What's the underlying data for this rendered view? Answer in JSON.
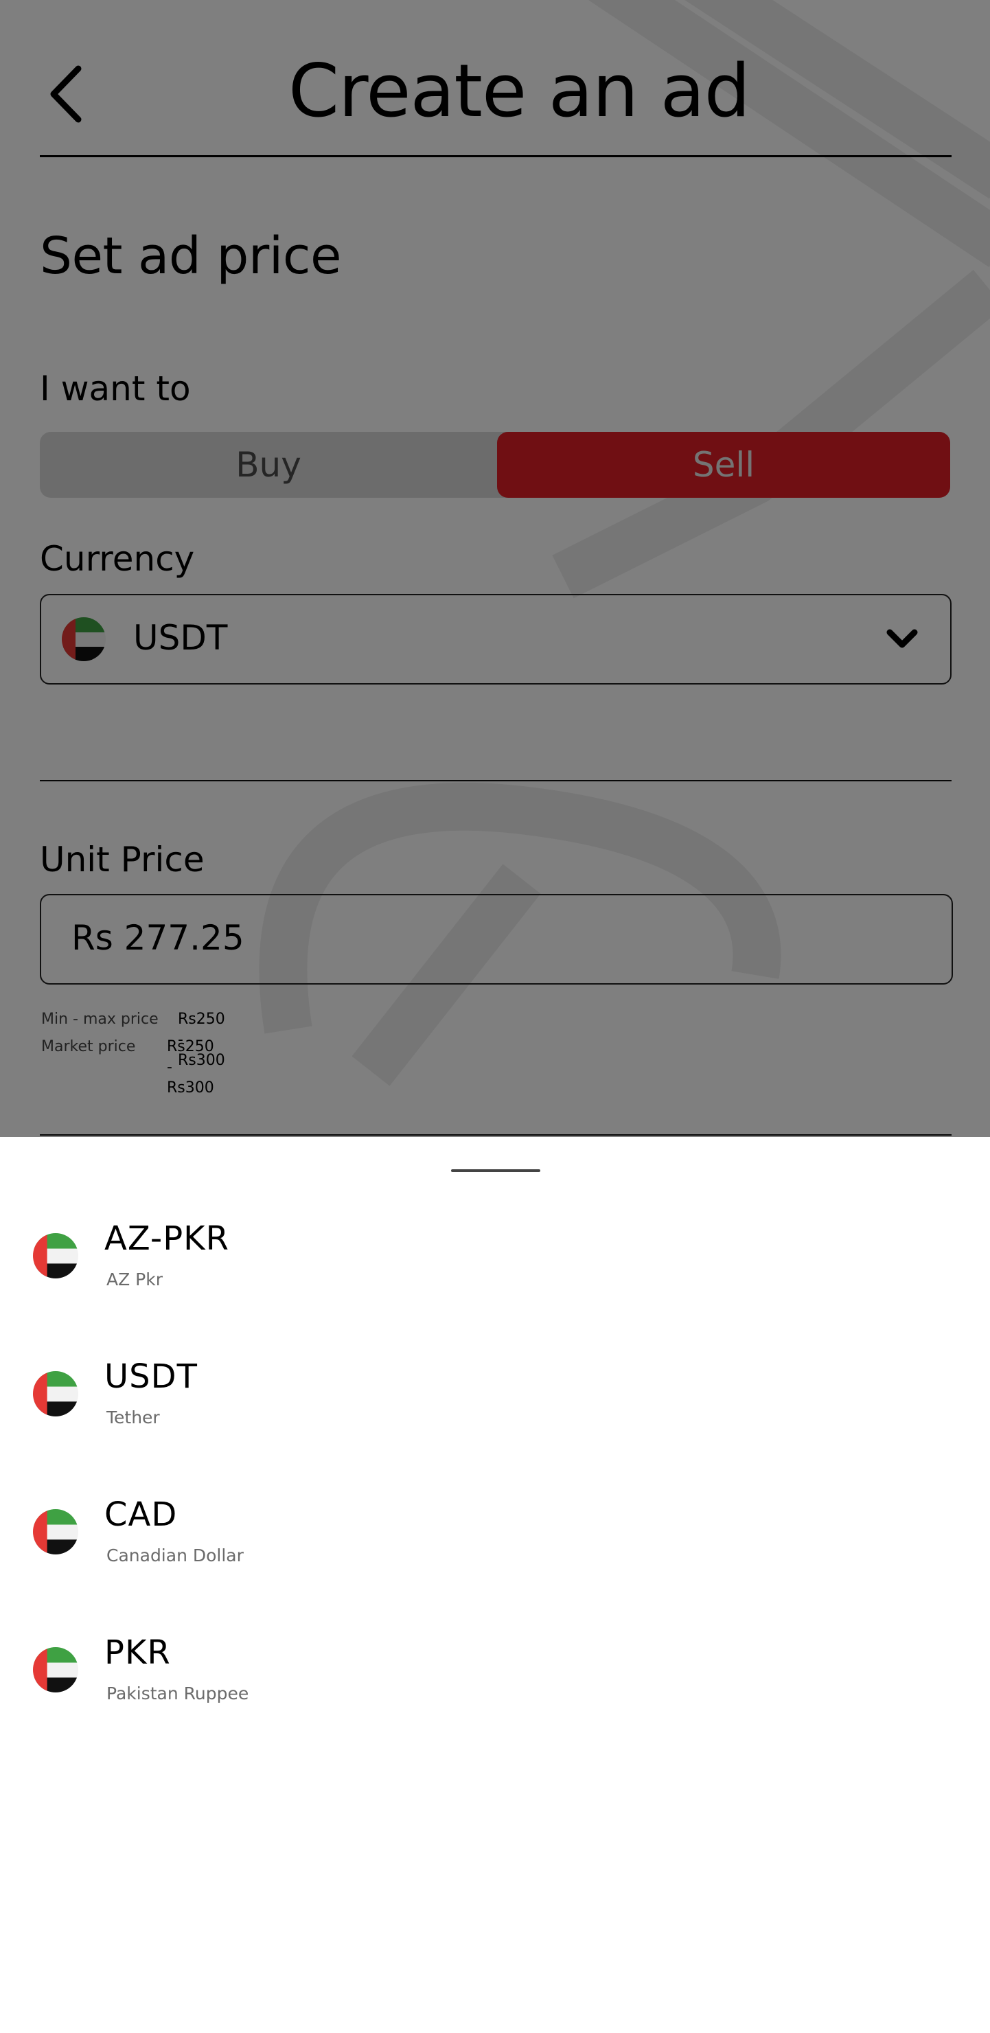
{
  "header": {
    "title": "Create an ad",
    "back_icon": "chevron-left-icon"
  },
  "form": {
    "section_title": "Set ad price",
    "want_to_label": "I want to",
    "toggle": {
      "buy_label": "Buy",
      "sell_label": "Sell",
      "selected": "Sell"
    },
    "currency_label": "Currency",
    "currency_value": "USDT",
    "currency_flag_icon": "uae-flag-icon",
    "currency_dropdown_icon": "chevron-down-icon",
    "unit_price_label": "Unit Price",
    "unit_price_value": "Rs 277.25",
    "min_max_label": "Min - max price",
    "min_max_value": "Rs250 - Rs300",
    "market_label": "Market price",
    "market_value": "Rs250 - Rs300"
  },
  "sheet": {
    "items": [
      {
        "code": "AZ-PKR",
        "name": "AZ Pkr",
        "icon": "uae-flag-icon"
      },
      {
        "code": "USDT",
        "name": "Tether",
        "icon": "uae-flag-icon"
      },
      {
        "code": "CAD",
        "name": "Canadian Dollar",
        "icon": "uae-flag-icon"
      },
      {
        "code": "PKR",
        "name": "Pakistan Ruppee",
        "icon": "uae-flag-icon"
      }
    ]
  },
  "colors": {
    "accent": "#e01f26",
    "overlay": "rgba(0,0,0,0.5)",
    "flag_red": "#e53935",
    "flag_green": "#3fa143",
    "flag_black": "#111111"
  }
}
